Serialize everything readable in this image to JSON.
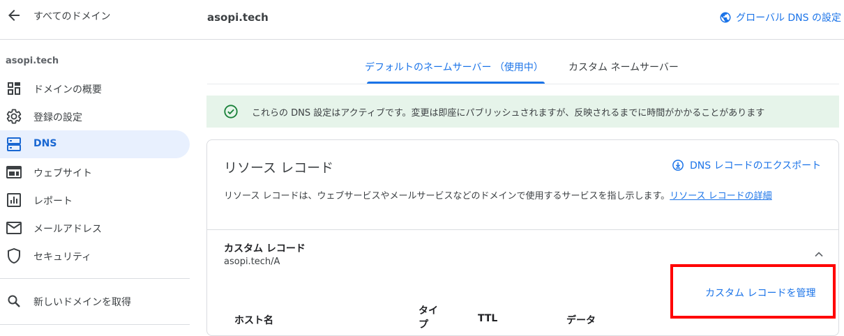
{
  "header": {
    "back_label": "すべてのドメイン",
    "domain": "asopi.tech",
    "global_dns_label": "グローバル DNS の設定"
  },
  "sidebar": {
    "domain": "asopi.tech",
    "items": [
      {
        "label": "ドメインの概要",
        "icon": "dashboard-icon"
      },
      {
        "label": "登録の設定",
        "icon": "gear-icon"
      },
      {
        "label": "DNS",
        "icon": "dns-icon",
        "active": true
      },
      {
        "label": "ウェブサイト",
        "icon": "web-icon"
      },
      {
        "label": "レポート",
        "icon": "report-icon"
      },
      {
        "label": "メールアドレス",
        "icon": "mail-icon"
      },
      {
        "label": "セキュリティ",
        "icon": "shield-icon"
      }
    ],
    "new_domain_label": "新しいドメインを取得"
  },
  "tabs": [
    {
      "label": "デフォルトのネームサーバー （使用中）",
      "active": true
    },
    {
      "label": "カスタム ネームサーバー",
      "active": false
    }
  ],
  "alert": {
    "text": "これらの DNS 設定はアクティブです。変更は即座にパブリッシュされますが、反映されるまでに時間がかかることがあります"
  },
  "resource": {
    "title": "リソース レコード",
    "export_label": "DNS レコードのエクスポート",
    "description": "リソース レコードは、ウェブサービスやメールサービスなどのドメインで使用するサービスを指し示します。",
    "link": "リソース レコードの詳細"
  },
  "custom": {
    "title": "カスタム レコード",
    "subtitle": "asopi.tech/A",
    "manage_label": "カスタム レコードを管理",
    "columns": [
      "ホスト名",
      "タイプ",
      "TTL",
      "データ"
    ]
  },
  "colors": {
    "accent": "#1a73e8",
    "active_bg": "#e8f0fe",
    "alert_bg": "#e6f4ea",
    "alert_icon": "#188038",
    "highlight": "#ff0000"
  }
}
